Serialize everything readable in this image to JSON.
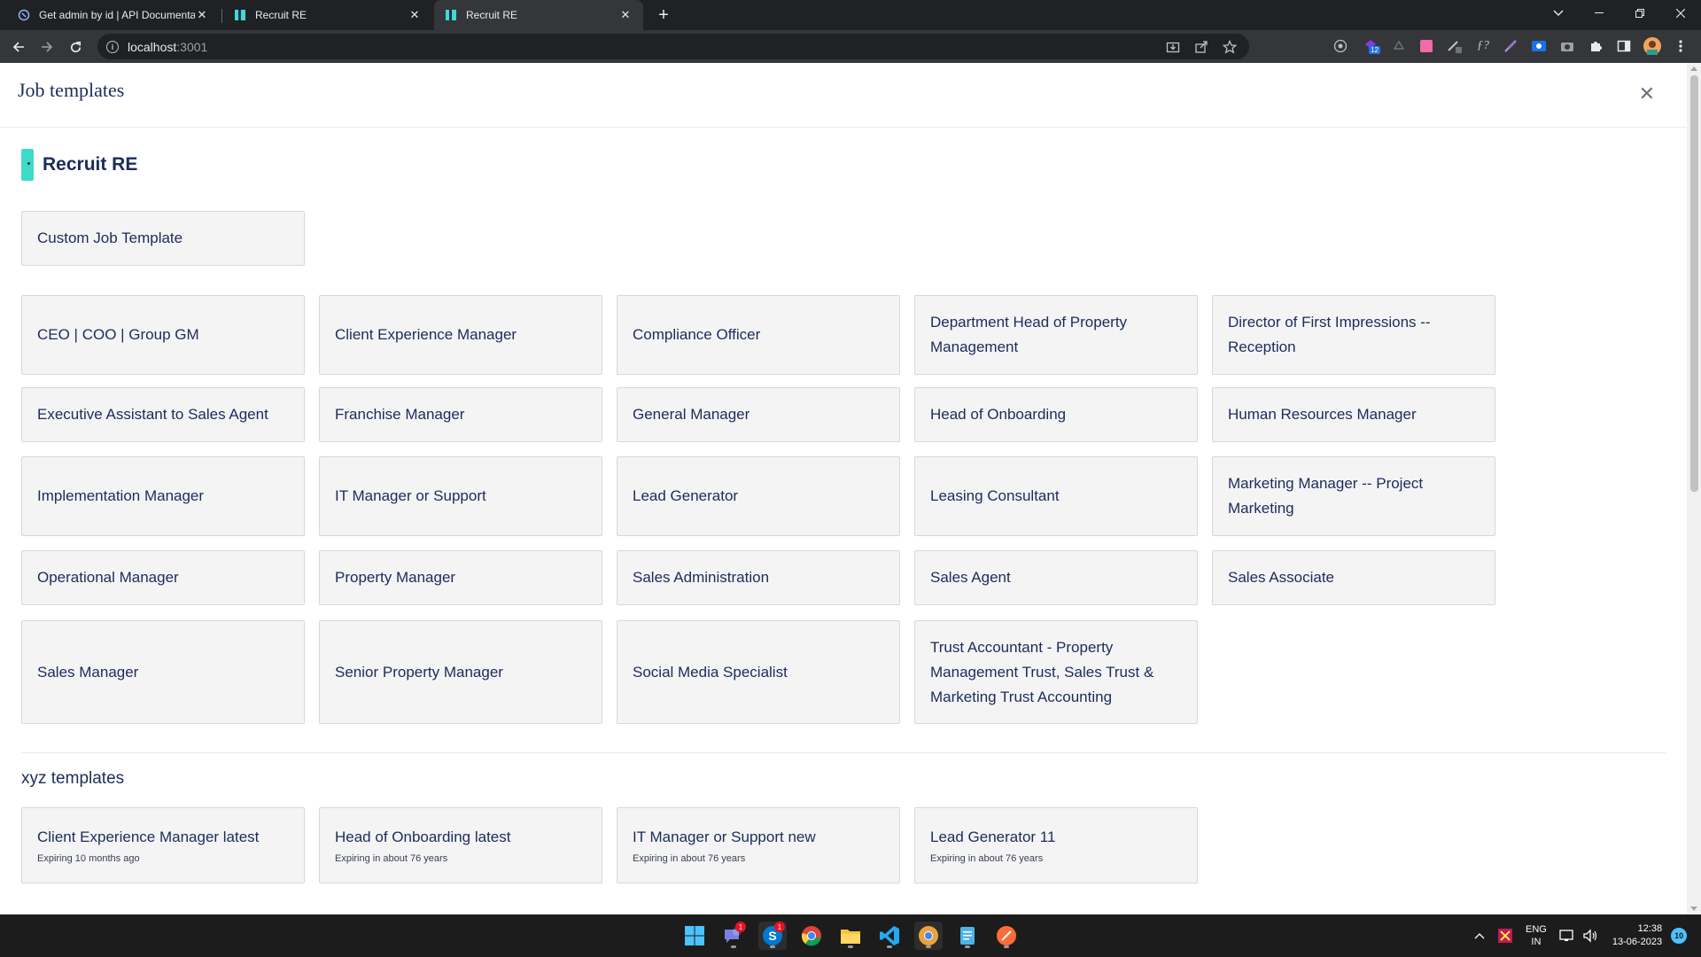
{
  "browser": {
    "tabs": [
      {
        "title": "Get admin by id | API Documenta",
        "close": "✕"
      },
      {
        "title": "Recruit RE",
        "close": "✕"
      },
      {
        "title": "Recruit RE",
        "close": "✕"
      }
    ],
    "new_tab": "+",
    "url_host": "localhost",
    "url_port": ":3001",
    "extension_badge": "12"
  },
  "modal": {
    "title": "Job templates",
    "close_label": "✕"
  },
  "brand": {
    "name": "Recruit RE"
  },
  "custom_template": {
    "label": "Custom Job Template"
  },
  "templates": [
    "CEO | COO | Group GM",
    "Client Experience Manager",
    "Compliance Officer",
    "Department Head of Property Management",
    "Director of First Impressions -- Reception",
    "Executive Assistant to Sales Agent",
    "Franchise Manager",
    "General Manager",
    "Head of Onboarding",
    "Human Resources Manager",
    "Implementation Manager",
    "IT Manager or Support",
    "Lead Generator",
    "Leasing Consultant",
    "Marketing Manager -- Project Marketing",
    "Operational Manager",
    "Property Manager",
    "Sales Administration",
    "Sales Agent",
    "Sales Associate",
    "Sales Manager",
    "Senior Property Manager",
    "Social Media Specialist",
    "Trust Accountant - Property Management Trust, Sales Trust & Marketing Trust Accounting"
  ],
  "custom_section": {
    "title": "xyz templates",
    "items": [
      {
        "label": "Client Experience Manager latest",
        "expiry": "Expiring 10 months ago"
      },
      {
        "label": "Head of Onboarding latest",
        "expiry": "Expiring in about 76 years"
      },
      {
        "label": "IT Manager or Support new",
        "expiry": "Expiring in about 76 years"
      },
      {
        "label": "Lead Generator 11",
        "expiry": "Expiring in about 76 years"
      }
    ]
  },
  "taskbar": {
    "chat_badge": "1",
    "skype_badge": "1",
    "lang_line1": "ENG",
    "lang_line2": "IN",
    "time": "12:38",
    "date": "13-06-2023",
    "notification_count": "10"
  }
}
